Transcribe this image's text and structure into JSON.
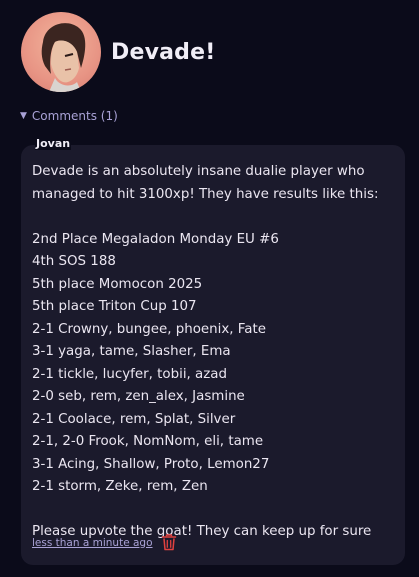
{
  "post": {
    "title": "Devade!"
  },
  "comments": {
    "toggle_label": "Comments (1)",
    "items": [
      {
        "author": "Jovan",
        "lines": [
          "Devade is an absolutely insane dualie player who",
          "managed to hit 3100xp! They have results like this:",
          "",
          "2nd Place Megaladon Monday EU #6",
          "4th SOS 188",
          "5th place Momocon 2025",
          "5th place Triton Cup 107",
          "2-1 Crowny, bungee, phoenix, Fate",
          "3-1 yaga, tame, Slasher, Ema",
          "2-1 tickle, lucyfer, tobii, azad",
          "2-0 seb, rem, zen_alex, Jasmine",
          "2-1 Coolace, rem, Splat, Silver",
          "2-1, 2-0 Frook, NomNom, eli, tame",
          "3-1 Acing, Shallow, Proto, Lemon27",
          "2-1 storm, Zeke, rem, Zen",
          "",
          "Please upvote the goat! They can keep up for sure"
        ],
        "timestamp": "less than a minute ago"
      }
    ]
  },
  "icons": {
    "caret": "caret-down-icon",
    "delete": "trash-icon"
  },
  "colors": {
    "background": "#0b0b1a",
    "card": "#1b1a2c",
    "accent": "#a9a2d6",
    "delete": "#e0413f"
  }
}
